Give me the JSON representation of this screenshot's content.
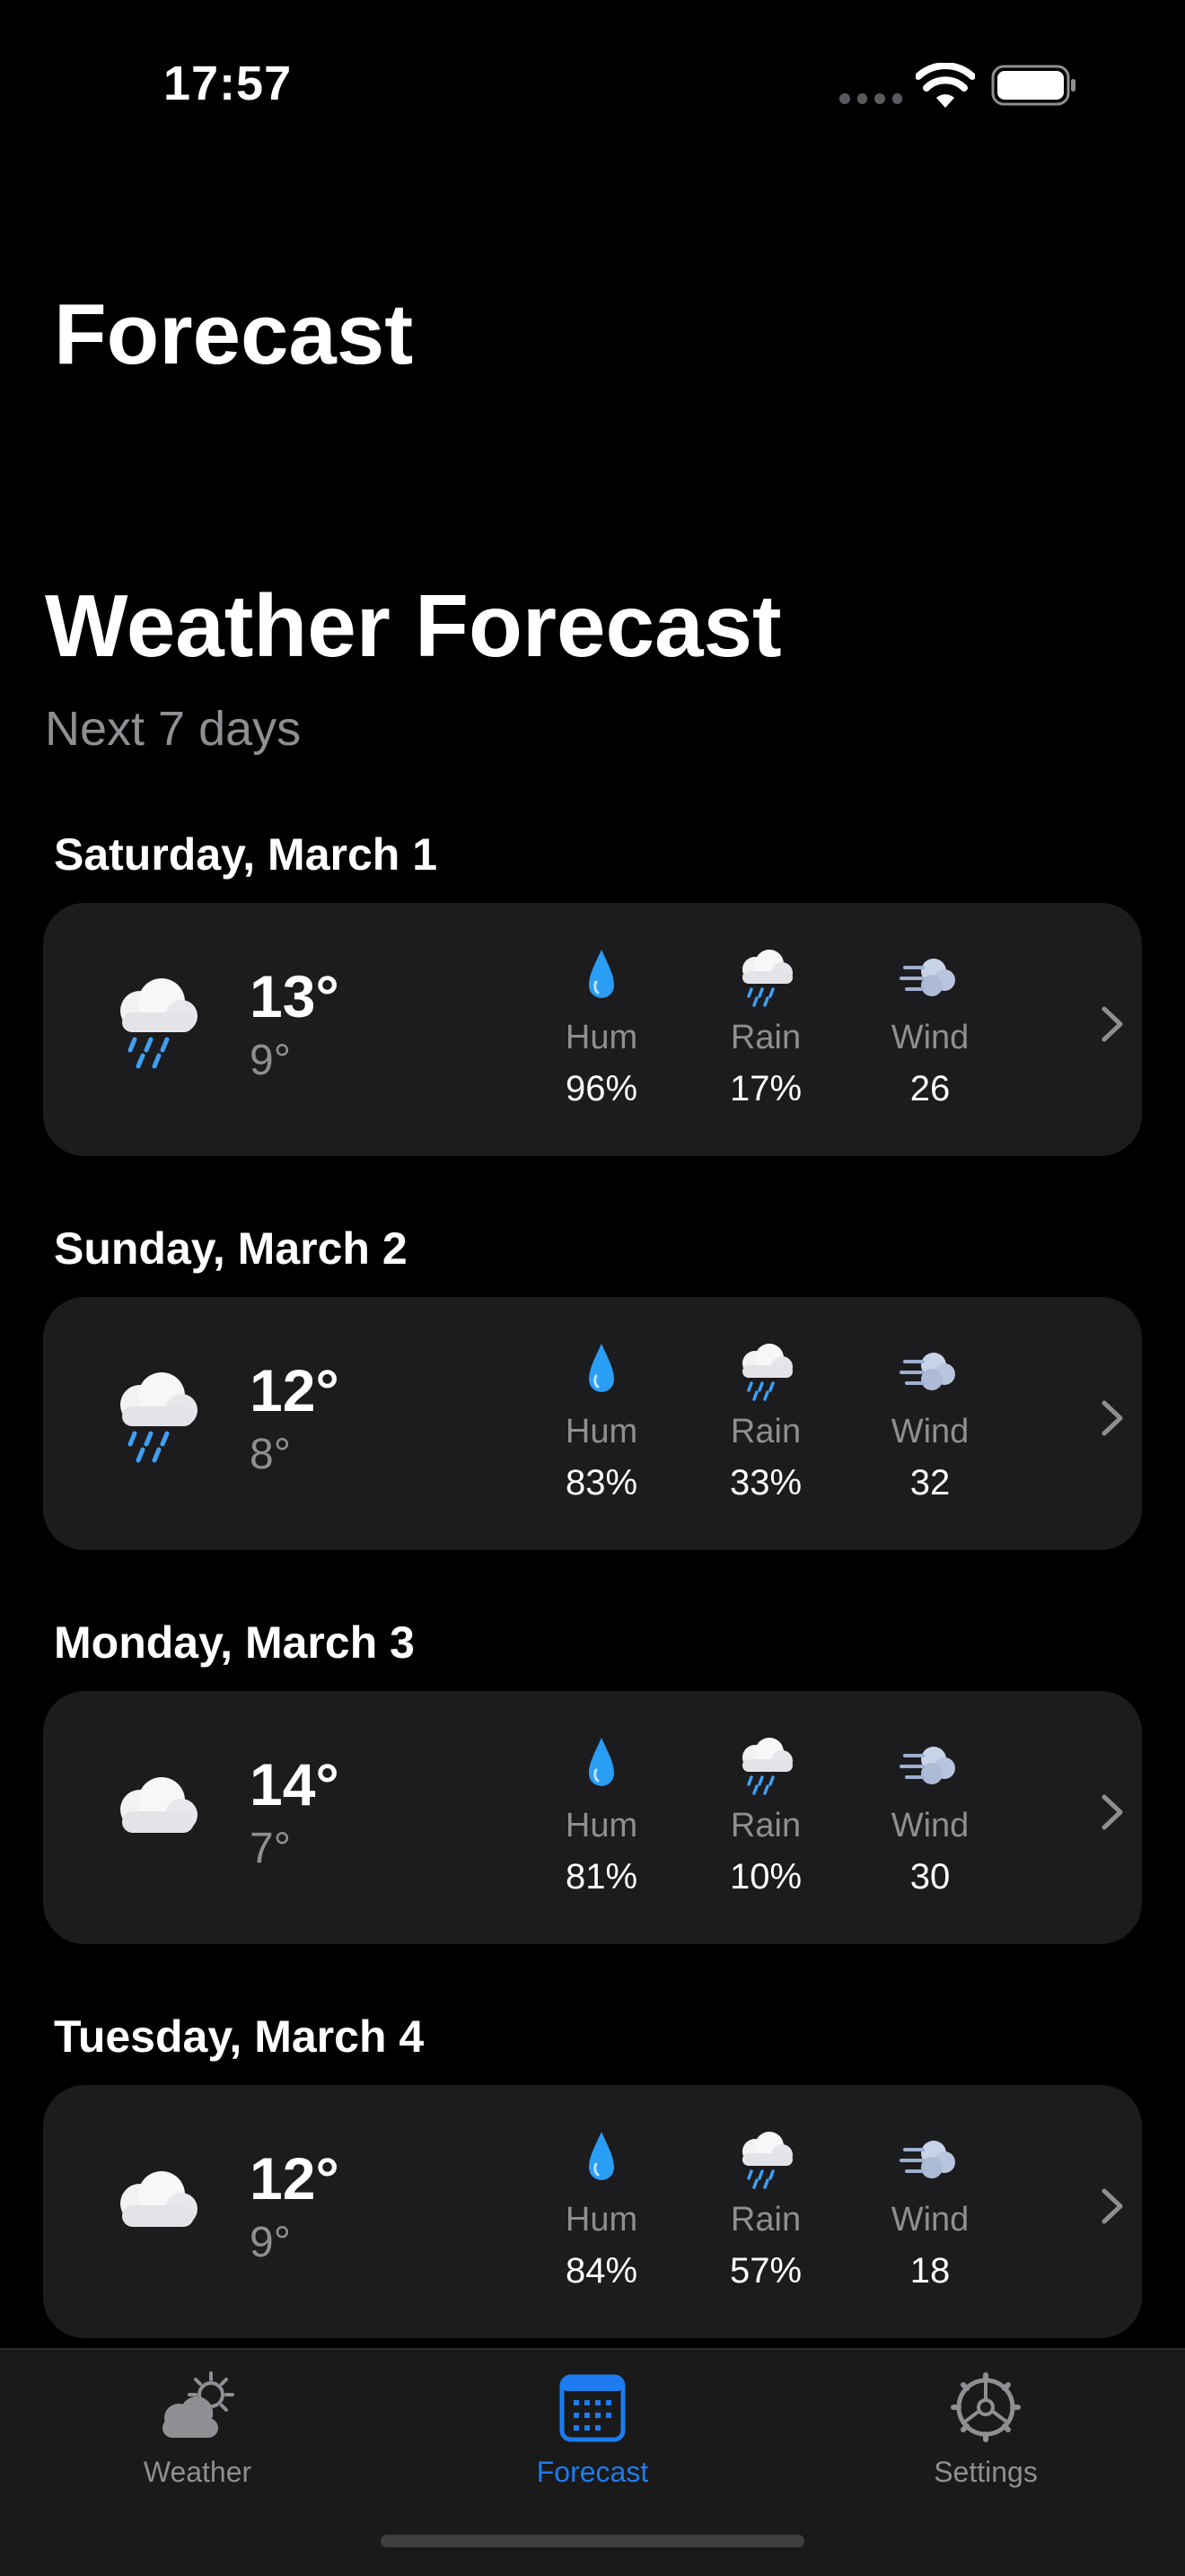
{
  "status_bar": {
    "time": "17:57"
  },
  "nav": {
    "title": "Forecast"
  },
  "header": {
    "title": "Weather Forecast",
    "subtitle": "Next 7 days"
  },
  "metric_labels": {
    "humidity": "Hum",
    "rain": "Rain",
    "wind": "Wind"
  },
  "days": [
    {
      "date": "Saturday, March 1",
      "condition_icon": "cloud-rain-icon",
      "high": "13°",
      "low": "9°",
      "humidity": "96%",
      "rain": "17%",
      "wind": "26"
    },
    {
      "date": "Sunday, March 2",
      "condition_icon": "cloud-rain-icon",
      "high": "12°",
      "low": "8°",
      "humidity": "83%",
      "rain": "33%",
      "wind": "32"
    },
    {
      "date": "Monday, March 3",
      "condition_icon": "cloud-icon",
      "high": "14°",
      "low": "7°",
      "humidity": "81%",
      "rain": "10%",
      "wind": "30"
    },
    {
      "date": "Tuesday, March 4",
      "condition_icon": "cloud-icon",
      "high": "12°",
      "low": "9°",
      "humidity": "84%",
      "rain": "57%",
      "wind": "18"
    }
  ],
  "tabs": [
    {
      "label": "Weather",
      "icon": "cloud-sun-icon",
      "active": false
    },
    {
      "label": "Forecast",
      "icon": "calendar-icon",
      "active": true
    },
    {
      "label": "Settings",
      "icon": "gear-icon",
      "active": false
    }
  ],
  "colors": {
    "accent": "#1c7cf0",
    "card": "#1c1c1e",
    "secondary_text": "#8e8e93",
    "background": "#000000"
  }
}
